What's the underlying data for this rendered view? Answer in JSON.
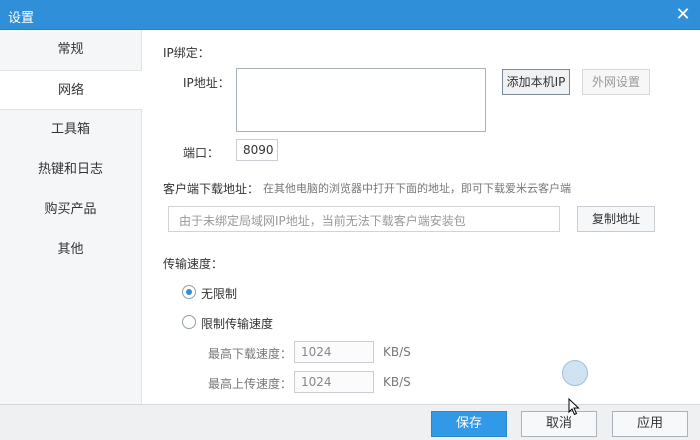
{
  "window": {
    "title": "设置",
    "close_glyph": "✕"
  },
  "sidebar": {
    "items": [
      {
        "label": "常规"
      },
      {
        "label": "网络"
      },
      {
        "label": "工具箱"
      },
      {
        "label": "热键和日志"
      },
      {
        "label": "购买产品"
      },
      {
        "label": "其他"
      }
    ],
    "active_index": 1
  },
  "network": {
    "ip_binding_title": "IP绑定：",
    "ip_address_label": "IP地址：",
    "ip_address_value": "",
    "add_local_ip_label": "添加本机IP",
    "external_settings_label": "外网设置",
    "port_label": "端口：",
    "port_value": "8090",
    "client_download_title": "客户端下载地址：",
    "client_download_hint": "在其他电脑的浏览器中打开下面的地址，即可下载爱米云客户端",
    "client_download_placeholder": "由于未绑定局域网IP地址，当前无法下载客户端安装包",
    "copy_address_label": "复制地址",
    "transfer_speed_title": "传输速度：",
    "unlimited_label": "无限制",
    "limit_speed_label": "限制传输速度",
    "unlimited_checked": true,
    "max_download_label": "最高下载速度：",
    "max_download_value": "1024",
    "max_upload_label": "最高上传速度：",
    "max_upload_value": "1024",
    "unit": "KB/S"
  },
  "footer": {
    "save_label": "保存",
    "cancel_label": "取消",
    "apply_label": "应用"
  },
  "colors": {
    "titlebar": "#2f8fd8",
    "primary": "#3298e8"
  },
  "icons": {
    "close": "close-icon",
    "cursor": "mouse-cursor-icon"
  }
}
